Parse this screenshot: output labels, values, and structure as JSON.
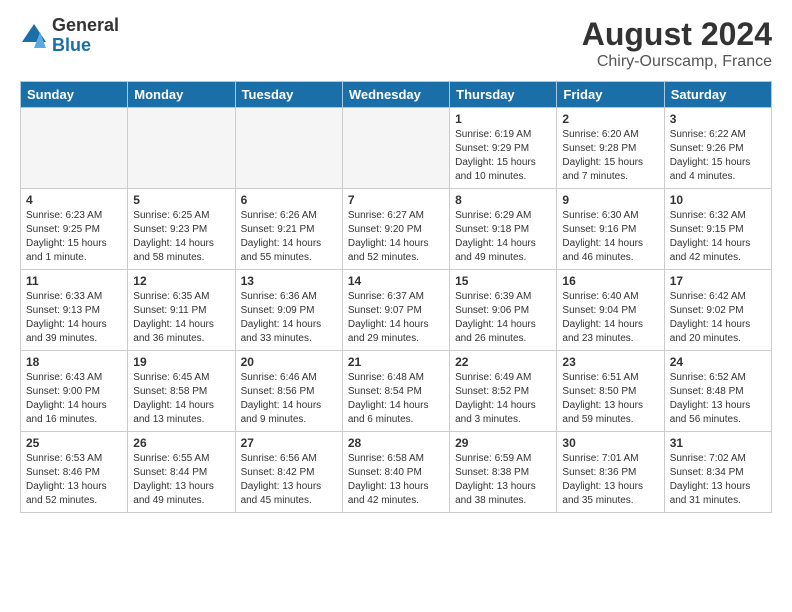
{
  "logo": {
    "general": "General",
    "blue": "Blue"
  },
  "header": {
    "month_year": "August 2024",
    "location": "Chiry-Ourscamp, France"
  },
  "days_of_week": [
    "Sunday",
    "Monday",
    "Tuesday",
    "Wednesday",
    "Thursday",
    "Friday",
    "Saturday"
  ],
  "weeks": [
    [
      {
        "day": "",
        "info": ""
      },
      {
        "day": "",
        "info": ""
      },
      {
        "day": "",
        "info": ""
      },
      {
        "day": "",
        "info": ""
      },
      {
        "day": "1",
        "info": "Sunrise: 6:19 AM\nSunset: 9:29 PM\nDaylight: 15 hours\nand 10 minutes."
      },
      {
        "day": "2",
        "info": "Sunrise: 6:20 AM\nSunset: 9:28 PM\nDaylight: 15 hours\nand 7 minutes."
      },
      {
        "day": "3",
        "info": "Sunrise: 6:22 AM\nSunset: 9:26 PM\nDaylight: 15 hours\nand 4 minutes."
      }
    ],
    [
      {
        "day": "4",
        "info": "Sunrise: 6:23 AM\nSunset: 9:25 PM\nDaylight: 15 hours\nand 1 minute."
      },
      {
        "day": "5",
        "info": "Sunrise: 6:25 AM\nSunset: 9:23 PM\nDaylight: 14 hours\nand 58 minutes."
      },
      {
        "day": "6",
        "info": "Sunrise: 6:26 AM\nSunset: 9:21 PM\nDaylight: 14 hours\nand 55 minutes."
      },
      {
        "day": "7",
        "info": "Sunrise: 6:27 AM\nSunset: 9:20 PM\nDaylight: 14 hours\nand 52 minutes."
      },
      {
        "day": "8",
        "info": "Sunrise: 6:29 AM\nSunset: 9:18 PM\nDaylight: 14 hours\nand 49 minutes."
      },
      {
        "day": "9",
        "info": "Sunrise: 6:30 AM\nSunset: 9:16 PM\nDaylight: 14 hours\nand 46 minutes."
      },
      {
        "day": "10",
        "info": "Sunrise: 6:32 AM\nSunset: 9:15 PM\nDaylight: 14 hours\nand 42 minutes."
      }
    ],
    [
      {
        "day": "11",
        "info": "Sunrise: 6:33 AM\nSunset: 9:13 PM\nDaylight: 14 hours\nand 39 minutes."
      },
      {
        "day": "12",
        "info": "Sunrise: 6:35 AM\nSunset: 9:11 PM\nDaylight: 14 hours\nand 36 minutes."
      },
      {
        "day": "13",
        "info": "Sunrise: 6:36 AM\nSunset: 9:09 PM\nDaylight: 14 hours\nand 33 minutes."
      },
      {
        "day": "14",
        "info": "Sunrise: 6:37 AM\nSunset: 9:07 PM\nDaylight: 14 hours\nand 29 minutes."
      },
      {
        "day": "15",
        "info": "Sunrise: 6:39 AM\nSunset: 9:06 PM\nDaylight: 14 hours\nand 26 minutes."
      },
      {
        "day": "16",
        "info": "Sunrise: 6:40 AM\nSunset: 9:04 PM\nDaylight: 14 hours\nand 23 minutes."
      },
      {
        "day": "17",
        "info": "Sunrise: 6:42 AM\nSunset: 9:02 PM\nDaylight: 14 hours\nand 20 minutes."
      }
    ],
    [
      {
        "day": "18",
        "info": "Sunrise: 6:43 AM\nSunset: 9:00 PM\nDaylight: 14 hours\nand 16 minutes."
      },
      {
        "day": "19",
        "info": "Sunrise: 6:45 AM\nSunset: 8:58 PM\nDaylight: 14 hours\nand 13 minutes."
      },
      {
        "day": "20",
        "info": "Sunrise: 6:46 AM\nSunset: 8:56 PM\nDaylight: 14 hours\nand 9 minutes."
      },
      {
        "day": "21",
        "info": "Sunrise: 6:48 AM\nSunset: 8:54 PM\nDaylight: 14 hours\nand 6 minutes."
      },
      {
        "day": "22",
        "info": "Sunrise: 6:49 AM\nSunset: 8:52 PM\nDaylight: 14 hours\nand 3 minutes."
      },
      {
        "day": "23",
        "info": "Sunrise: 6:51 AM\nSunset: 8:50 PM\nDaylight: 13 hours\nand 59 minutes."
      },
      {
        "day": "24",
        "info": "Sunrise: 6:52 AM\nSunset: 8:48 PM\nDaylight: 13 hours\nand 56 minutes."
      }
    ],
    [
      {
        "day": "25",
        "info": "Sunrise: 6:53 AM\nSunset: 8:46 PM\nDaylight: 13 hours\nand 52 minutes."
      },
      {
        "day": "26",
        "info": "Sunrise: 6:55 AM\nSunset: 8:44 PM\nDaylight: 13 hours\nand 49 minutes."
      },
      {
        "day": "27",
        "info": "Sunrise: 6:56 AM\nSunset: 8:42 PM\nDaylight: 13 hours\nand 45 minutes."
      },
      {
        "day": "28",
        "info": "Sunrise: 6:58 AM\nSunset: 8:40 PM\nDaylight: 13 hours\nand 42 minutes."
      },
      {
        "day": "29",
        "info": "Sunrise: 6:59 AM\nSunset: 8:38 PM\nDaylight: 13 hours\nand 38 minutes."
      },
      {
        "day": "30",
        "info": "Sunrise: 7:01 AM\nSunset: 8:36 PM\nDaylight: 13 hours\nand 35 minutes."
      },
      {
        "day": "31",
        "info": "Sunrise: 7:02 AM\nSunset: 8:34 PM\nDaylight: 13 hours\nand 31 minutes."
      }
    ]
  ]
}
